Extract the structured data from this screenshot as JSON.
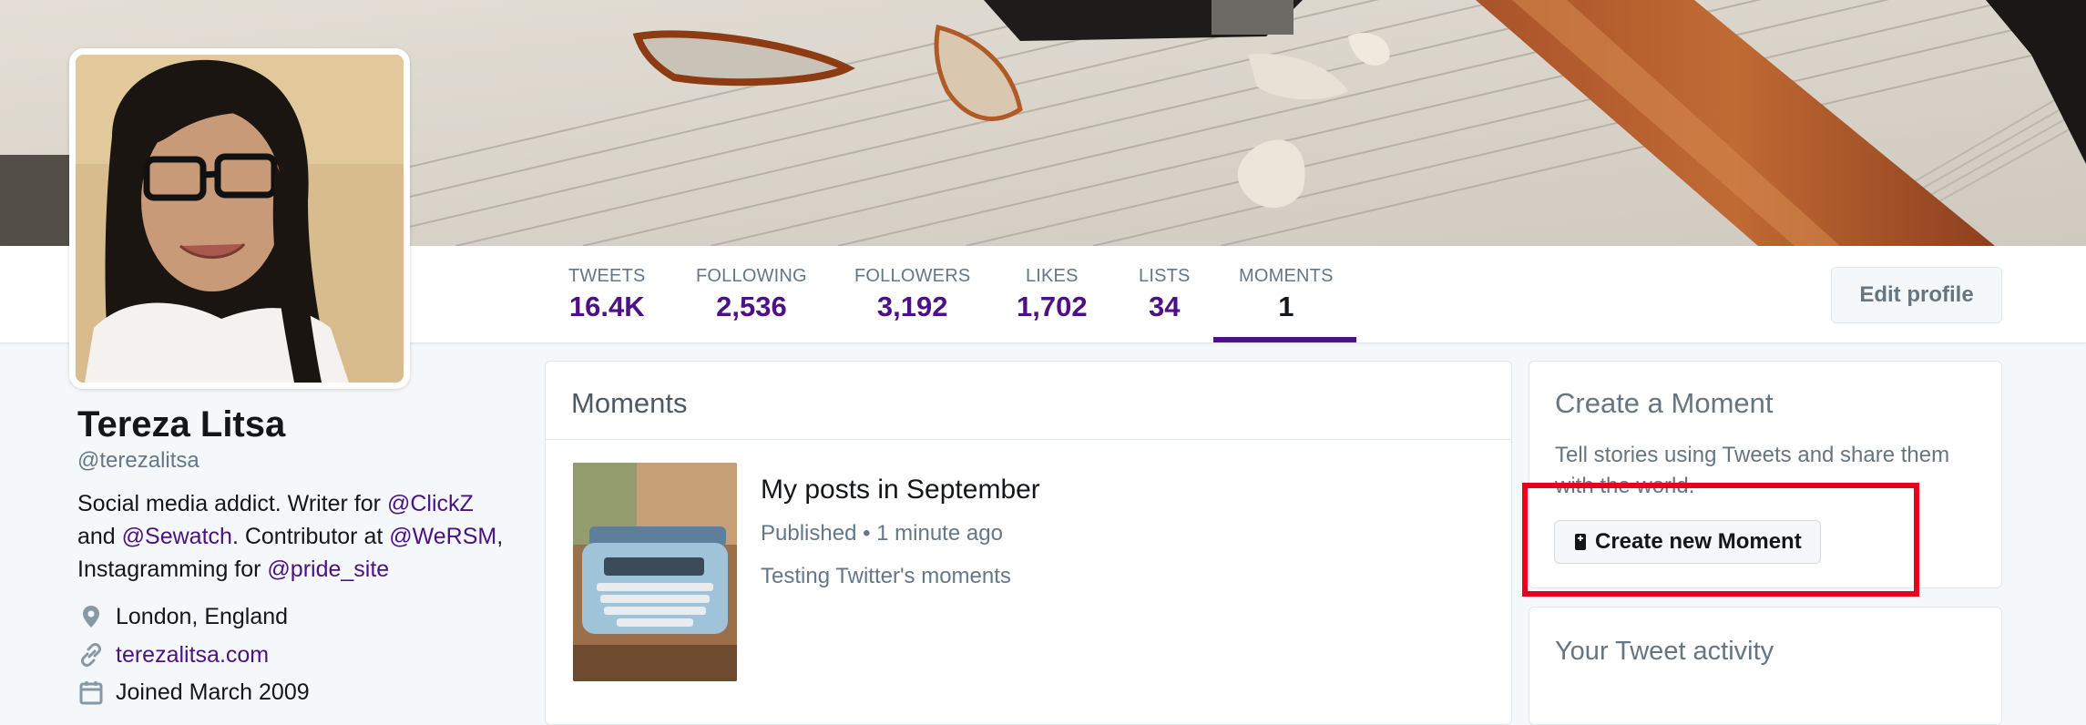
{
  "profile": {
    "name": "Tereza Litsa",
    "handle": "@terezalitsa",
    "bio": {
      "p1": "Social media addict. Writer for ",
      "link1": "@ClickZ",
      "p2": " and ",
      "link2": "@Sewatch",
      "p3": ". Contributor at ",
      "link3": "@WeRSM",
      "p4": ", Instagramming for ",
      "link4": "@pride_site"
    },
    "location": "London, England",
    "website": "terezalitsa.com",
    "joined": "Joined March 2009"
  },
  "nav": {
    "stats": [
      {
        "label": "TWEETS",
        "value": "16.4K"
      },
      {
        "label": "FOLLOWING",
        "value": "2,536"
      },
      {
        "label": "FOLLOWERS",
        "value": "3,192"
      },
      {
        "label": "LIKES",
        "value": "1,702"
      },
      {
        "label": "LISTS",
        "value": "34"
      },
      {
        "label": "MOMENTS",
        "value": "1"
      }
    ],
    "active_tab": "MOMENTS",
    "edit_profile_label": "Edit profile"
  },
  "moments_card": {
    "heading": "Moments",
    "item": {
      "title": "My posts in September",
      "meta": "Published • 1 minute ago",
      "description": "Testing Twitter's moments"
    }
  },
  "create_moment_card": {
    "heading": "Create a Moment",
    "description": "Tell stories using Tweets and share them with the world.",
    "button_label": "Create new Moment"
  },
  "activity_card": {
    "heading": "Your Tweet activity"
  },
  "icons": {
    "location": "location-pin-icon",
    "website": "link-icon",
    "joined": "calendar-icon",
    "create_button": "moment-icon"
  },
  "colors": {
    "accent": "#4b1185",
    "highlight_box": "#e8001c",
    "text_secondary": "#657786"
  }
}
